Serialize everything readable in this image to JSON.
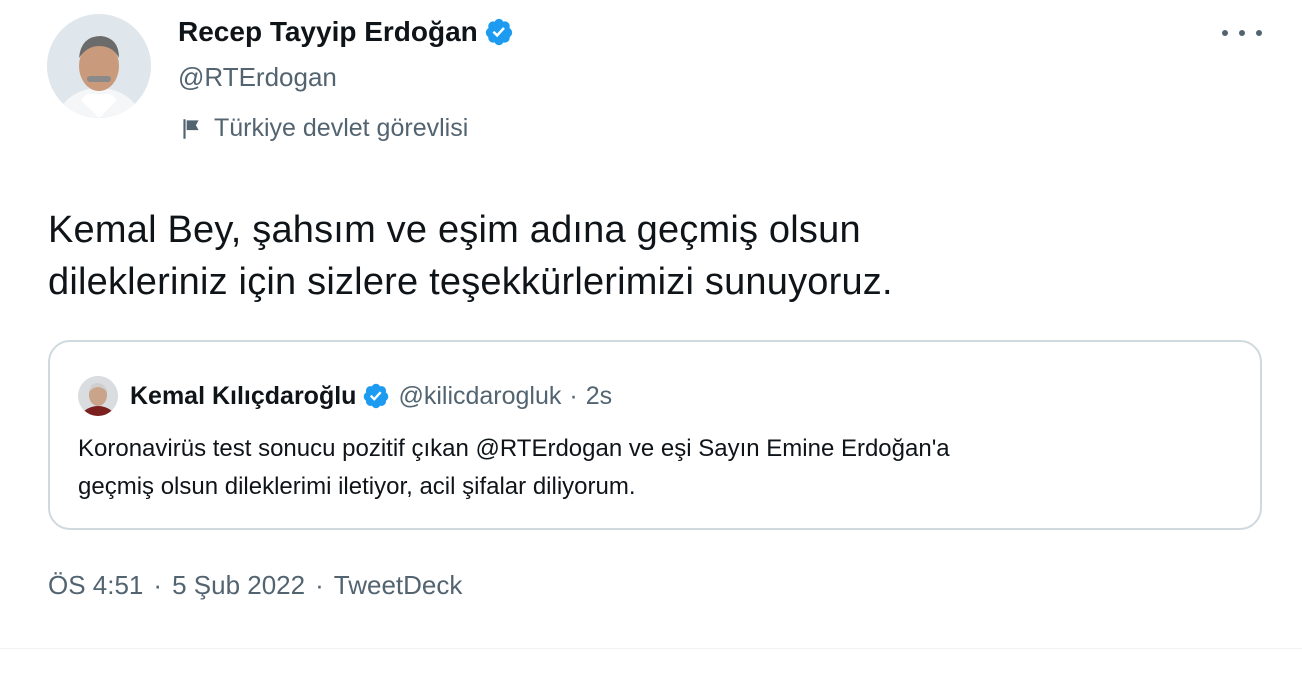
{
  "author": {
    "name": "Recep Tayyip Erdoğan",
    "handle": "@RTErdogan",
    "label": "Türkiye devlet görevlisi"
  },
  "tweet": {
    "lines": [
      "Kemal Bey, şahsım ve eşim adına geçmiş olsun",
      "dilekleriniz için sizlere teşekkürlerimizi sunuyoruz."
    ]
  },
  "quoted": {
    "name": "Kemal Kılıçdaroğlu",
    "handle": "@kilicdarogluk",
    "dot": "·",
    "time": "2s",
    "lines": [
      "Koronavirüs test sonucu pozitif çıkan @RTErdogan ve eşi Sayın Emine Erdoğan'a",
      "geçmiş olsun dileklerimi iletiyor, acil şifalar diliyorum."
    ]
  },
  "meta": {
    "time": "ÖS 4:51",
    "sep1": "·",
    "date": "5 Şub 2022",
    "sep2": "·",
    "source": "TweetDeck"
  },
  "colors": {
    "verified": "#1d9bf0",
    "secondary_text": "#536471",
    "border": "#cfd9de"
  },
  "icons": {
    "verified": "verified-badge-icon",
    "flag": "flag-icon",
    "more": "more-options-icon"
  }
}
